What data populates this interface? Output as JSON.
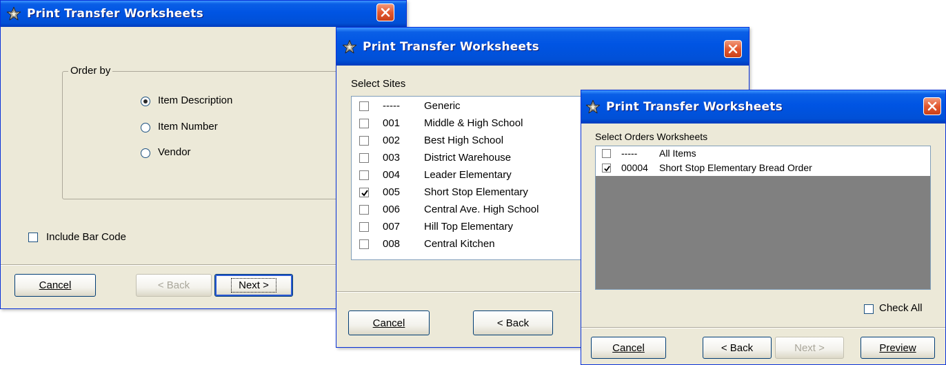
{
  "window1": {
    "title": "Print Transfer Worksheets",
    "group_label": "Order by",
    "options": [
      {
        "label": "Item Description",
        "selected": true
      },
      {
        "label": "Item Number",
        "selected": false
      },
      {
        "label": "Vendor",
        "selected": false
      }
    ],
    "include_bar_code": {
      "label": "Include Bar Code",
      "checked": false
    },
    "buttons": {
      "cancel": "Cancel",
      "back": "< Back",
      "next": "Next >"
    }
  },
  "window2": {
    "title": "Print Transfer Worksheets",
    "list_label": "Select Sites",
    "sites": [
      {
        "code": "-----",
        "name": "Generic",
        "checked": false
      },
      {
        "code": "001",
        "name": "Middle & High School",
        "checked": false
      },
      {
        "code": "002",
        "name": "Best High School",
        "checked": false
      },
      {
        "code": "003",
        "name": "District Warehouse",
        "checked": false
      },
      {
        "code": "004",
        "name": "Leader Elementary",
        "checked": false
      },
      {
        "code": "005",
        "name": "Short Stop Elementary",
        "checked": true
      },
      {
        "code": "006",
        "name": "Central Ave. High School",
        "checked": false
      },
      {
        "code": "007",
        "name": "Hill Top Elementary",
        "checked": false
      },
      {
        "code": "008",
        "name": "Central Kitchen",
        "checked": false
      }
    ],
    "buttons": {
      "cancel": "Cancel",
      "back": "< Back"
    }
  },
  "window3": {
    "title": "Print Transfer Worksheets",
    "list_label": "Select Orders Worksheets",
    "worksheets": [
      {
        "code": "-----",
        "name": "All Items",
        "checked": false
      },
      {
        "code": "00004",
        "name": "Short Stop Elementary Bread Order",
        "checked": true
      }
    ],
    "check_all": {
      "label": "Check All",
      "checked": false
    },
    "buttons": {
      "cancel": "Cancel",
      "back": "< Back",
      "next": "Next >",
      "preview": "Preview"
    }
  },
  "colors": {
    "titlebar": "#0054e3",
    "window_bg": "#ece9d8",
    "list_empty_bg": "#808080",
    "close_button": "#e3582f"
  }
}
